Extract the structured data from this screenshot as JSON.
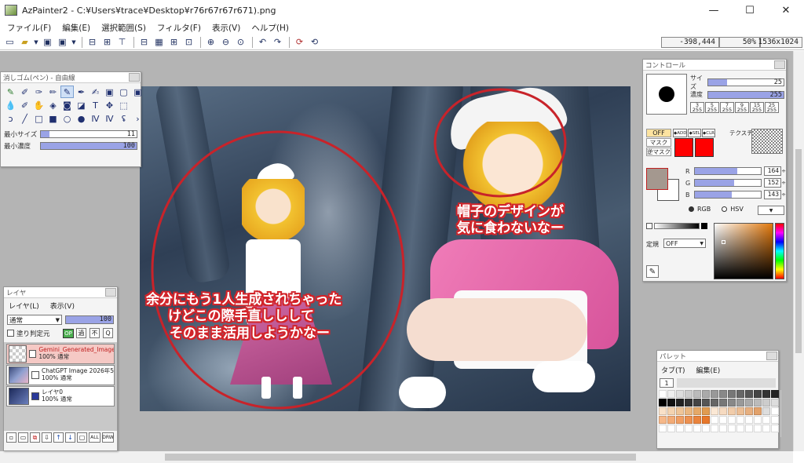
{
  "window": {
    "title": "AzPainter2 - C:¥Users¥trace¥Desktop¥r76r67r67r671).png",
    "minimize": "—",
    "maximize": "☐",
    "close": "✕"
  },
  "menu": [
    "ファイル(F)",
    "編集(E)",
    "選択範囲(S)",
    "フィルタ(F)",
    "表示(V)",
    "ヘルプ(H)"
  ],
  "status": {
    "coords": "-398,444",
    "zoom": "50%",
    "size": "1536x1024"
  },
  "canvas_text": {
    "left_caption": [
      "余分にもう1人生成されちゃった",
      "けどこの際手直ししして",
      "そのまま活用しようかなー"
    ],
    "right_caption": [
      "帽子のデザインが",
      "気に食わないなー"
    ]
  },
  "tool_panel": {
    "title": "消しゴム(ペン) - 自由線",
    "min_size_label": "最小サイズ",
    "min_size_value": "11",
    "min_density_label": "最小濃度",
    "min_density_value": "100"
  },
  "layer_panel": {
    "title": "レイヤ",
    "menu_layer": "レイヤ(L)",
    "menu_view": "表示(V)",
    "blend_mode": "通常",
    "opacity": "100",
    "checkbox_label": "塗り判定元",
    "mode_badge": "OP",
    "btn_ko": "過",
    "btn_fu": "不",
    "btn_q": "Q",
    "layers": [
      {
        "name": "Gemini_Generated_Image_st",
        "info": "100% 通常",
        "selected": true
      },
      {
        "name": "ChatGPT Image 2026年5",
        "info": "100% 通常",
        "selected": false
      },
      {
        "name": "レイヤ0",
        "info": "100% 通常",
        "selected": false
      }
    ],
    "footer_buttons": [
      "new",
      "open",
      "copy",
      "merge",
      "up",
      "down",
      "clear",
      "ALL",
      "DRW"
    ]
  },
  "control_panel": {
    "title": "コントロール",
    "size_label": "サイズ",
    "size_value": "25",
    "density_label": "濃度",
    "density_value": "255",
    "presets": [
      "255",
      "255",
      "255",
      "255",
      "255",
      "255",
      "255"
    ],
    "off_label": "OFF",
    "mask_label": "マスク",
    "reverse_mask_label": "逆マスク",
    "texture_label": "テクスチャ",
    "r_label": "R",
    "r_value": "164",
    "g_label": "G",
    "g_value": "152",
    "b_label": "B",
    "b_value": "143",
    "rgb_label": "RGB",
    "hsv_label": "HSV",
    "rule_label": "定規",
    "rule_value": "OFF"
  },
  "palette_panel": {
    "title": "パレット",
    "tab_tab": "タブ(T)",
    "tab_edit": "編集(E)",
    "tab_num": "1"
  },
  "colors": {
    "workspace": "#b4b4b4",
    "accent": "#9aa3e6",
    "caption_outline": "#d2242a",
    "fg_color": "#a4988f",
    "mask_red": "#ff0000"
  }
}
